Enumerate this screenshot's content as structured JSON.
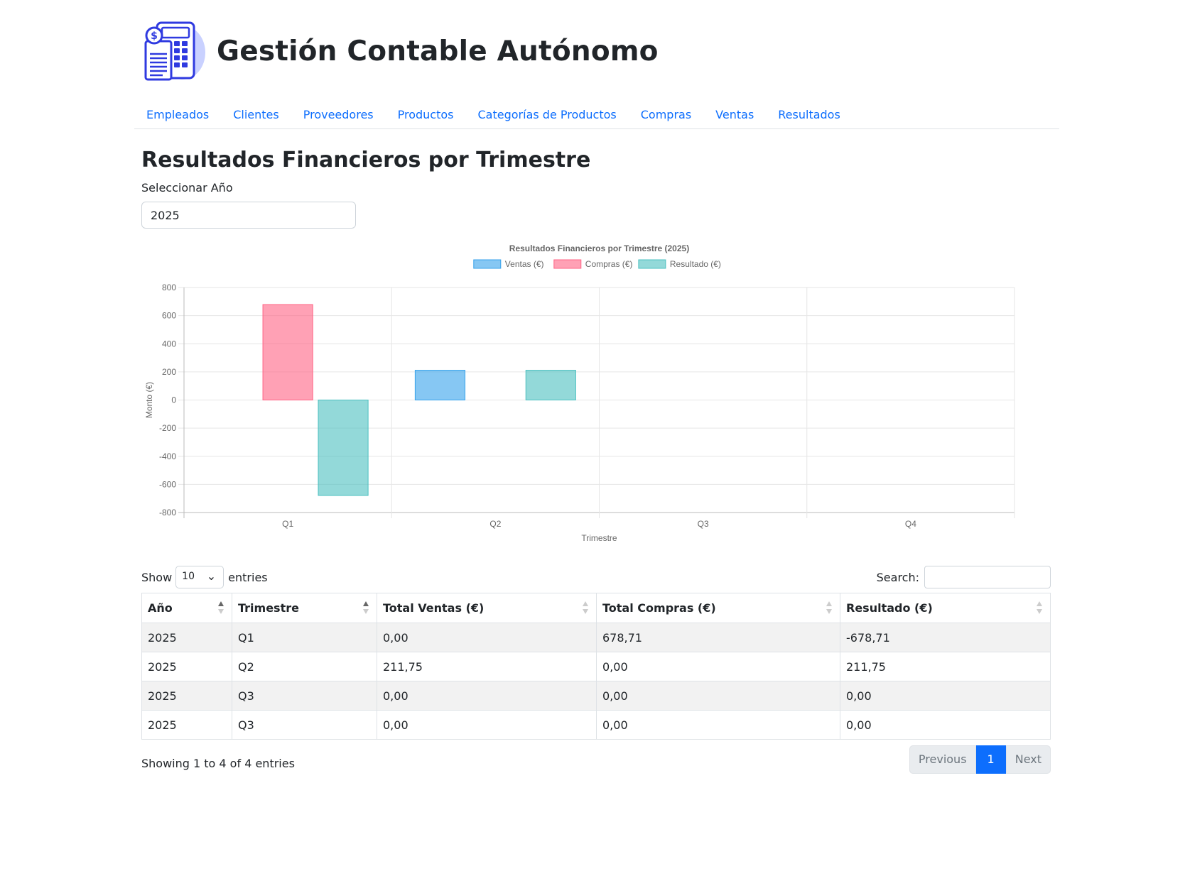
{
  "header": {
    "brand_title": "Gestión Contable Autónomo",
    "logo_icon": "accounting-calculator-icon"
  },
  "nav": {
    "items": [
      {
        "label": "Empleados"
      },
      {
        "label": "Clientes"
      },
      {
        "label": "Proveedores"
      },
      {
        "label": "Productos"
      },
      {
        "label": "Categorías de Productos"
      },
      {
        "label": "Compras"
      },
      {
        "label": "Ventas"
      },
      {
        "label": "Resultados"
      }
    ]
  },
  "main": {
    "title": "Resultados Financieros por Trimestre",
    "year_label": "Seleccionar Año",
    "year_value": "2025"
  },
  "chart_data": {
    "type": "bar",
    "title": "Resultados Financieros por Trimestre (2025)",
    "xlabel": "Trimestre",
    "ylabel": "Monto (€)",
    "categories": [
      "Q1",
      "Q2",
      "Q3",
      "Q4"
    ],
    "ylim": [
      -800,
      800
    ],
    "yticks": [
      800,
      600,
      400,
      200,
      0,
      -200,
      -400,
      -600,
      -800
    ],
    "grid": true,
    "legend_position": "top",
    "series": [
      {
        "name": "Ventas (€)",
        "color": "#36a2eb",
        "values": [
          0,
          211.75,
          0,
          0
        ]
      },
      {
        "name": "Compras (€)",
        "color": "#ff6384",
        "values": [
          678.71,
          0,
          0,
          0
        ]
      },
      {
        "name": "Resultado (€)",
        "color": "#4bc0c0",
        "values": [
          -678.71,
          211.75,
          0,
          0
        ]
      }
    ]
  },
  "table": {
    "length_label_pre": "Show",
    "length_value": "10",
    "length_label_post": "entries",
    "search_label": "Search:",
    "columns": [
      "Año",
      "Trimestre",
      "Total Ventas (€)",
      "Total Compras (€)",
      "Resultado (€)"
    ],
    "rows": [
      [
        "2025",
        "Q1",
        "0,00",
        "678,71",
        "-678,71"
      ],
      [
        "2025",
        "Q2",
        "211,75",
        "0,00",
        "211,75"
      ],
      [
        "2025",
        "Q3",
        "0,00",
        "0,00",
        "0,00"
      ],
      [
        "2025",
        "Q3",
        "0,00",
        "0,00",
        "0,00"
      ]
    ],
    "info": "Showing 1 to 4 of 4 entries",
    "pagination": {
      "previous": "Previous",
      "current": "1",
      "next": "Next"
    }
  }
}
